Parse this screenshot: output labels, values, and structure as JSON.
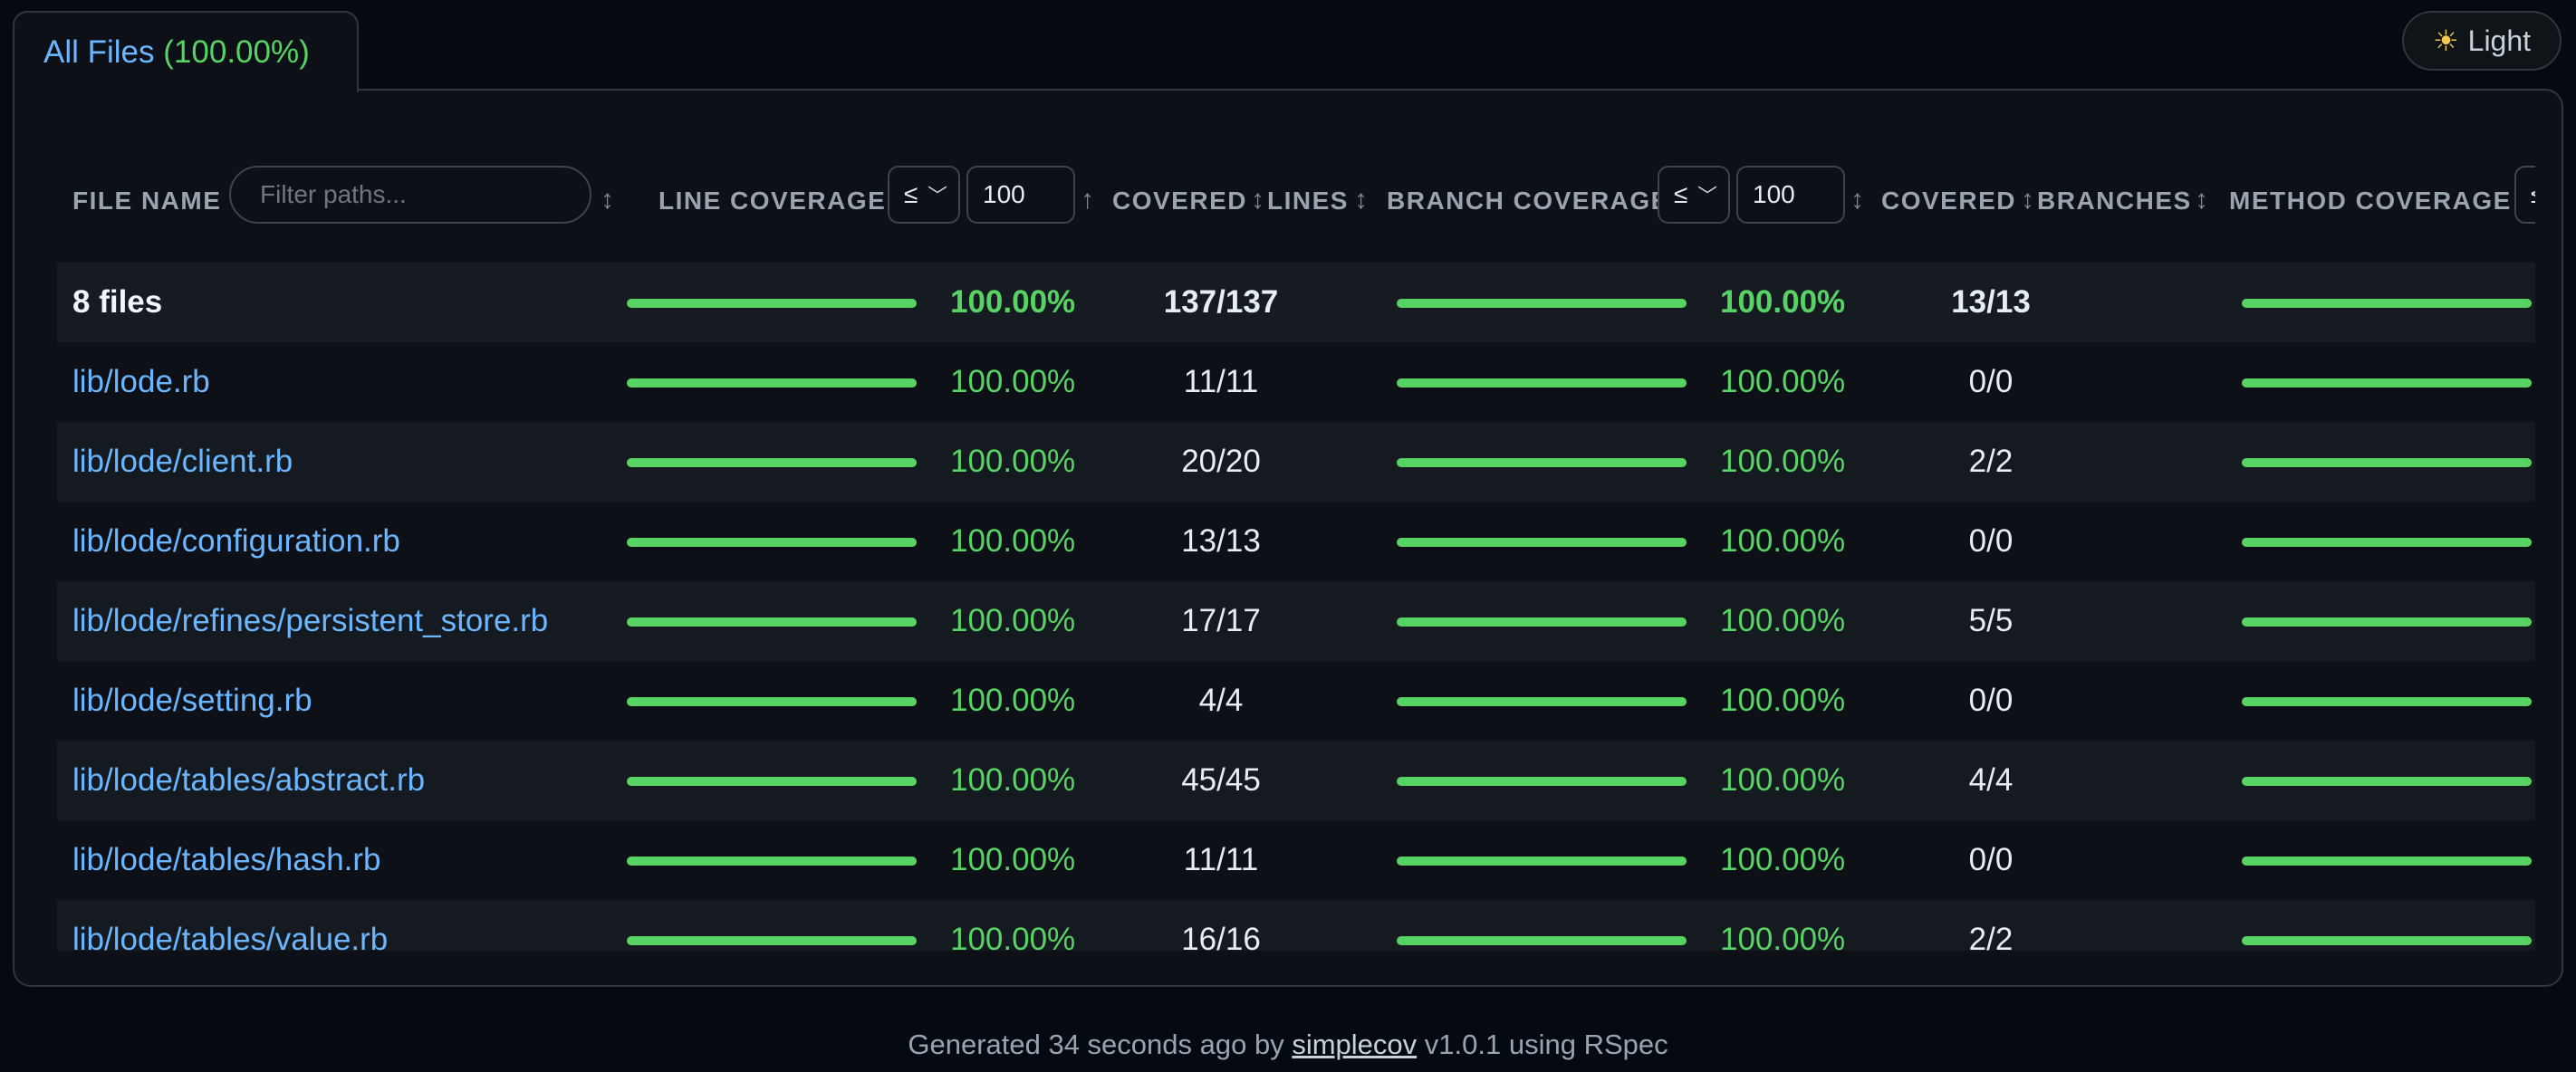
{
  "theme_toggle": {
    "icon": "sun-icon",
    "label": "Light"
  },
  "tab": {
    "label": "All Files",
    "percent": "(100.00%)"
  },
  "colors": {
    "accent_link": "#6cb6ff",
    "coverage_good": "#57d364",
    "background": "#050a12"
  },
  "header": {
    "file_name": "FILE NAME",
    "filter_placeholder": "Filter paths...",
    "line_coverage": "LINE COVERAGE",
    "line_op": "≤",
    "line_value": "100",
    "covered_1": "COVERED",
    "lines": "LINES",
    "branch_coverage": "BRANCH COVERAGE",
    "branch_op": "≤",
    "branch_value": "100",
    "covered_2": "COVERED",
    "branches": "BRANCHES",
    "method_coverage": "METHOD COVERAGE",
    "method_op": "≤"
  },
  "summary": {
    "name": "8 files",
    "line_pct": "100.00%",
    "line_fill": 1.0,
    "lines": "137/137",
    "branch_pct": "100.00%",
    "branch_fill": 1.0,
    "branches": "13/13",
    "method_fill": 1.0
  },
  "files": [
    {
      "name": "lib/lode.rb",
      "line_pct": "100.00%",
      "line_fill": 1.0,
      "lines": "11/11",
      "branch_pct": "100.00%",
      "branch_fill": 1.0,
      "branches": "0/0",
      "method_fill": 1.0
    },
    {
      "name": "lib/lode/client.rb",
      "line_pct": "100.00%",
      "line_fill": 1.0,
      "lines": "20/20",
      "branch_pct": "100.00%",
      "branch_fill": 1.0,
      "branches": "2/2",
      "method_fill": 1.0
    },
    {
      "name": "lib/lode/configuration.rb",
      "line_pct": "100.00%",
      "line_fill": 1.0,
      "lines": "13/13",
      "branch_pct": "100.00%",
      "branch_fill": 1.0,
      "branches": "0/0",
      "method_fill": 1.0
    },
    {
      "name": "lib/lode/refines/persistent_store.rb",
      "line_pct": "100.00%",
      "line_fill": 1.0,
      "lines": "17/17",
      "branch_pct": "100.00%",
      "branch_fill": 1.0,
      "branches": "5/5",
      "method_fill": 1.0
    },
    {
      "name": "lib/lode/setting.rb",
      "line_pct": "100.00%",
      "line_fill": 1.0,
      "lines": "4/4",
      "branch_pct": "100.00%",
      "branch_fill": 1.0,
      "branches": "0/0",
      "method_fill": 1.0
    },
    {
      "name": "lib/lode/tables/abstract.rb",
      "line_pct": "100.00%",
      "line_fill": 1.0,
      "lines": "45/45",
      "branch_pct": "100.00%",
      "branch_fill": 1.0,
      "branches": "4/4",
      "method_fill": 1.0
    },
    {
      "name": "lib/lode/tables/hash.rb",
      "line_pct": "100.00%",
      "line_fill": 1.0,
      "lines": "11/11",
      "branch_pct": "100.00%",
      "branch_fill": 1.0,
      "branches": "0/0",
      "method_fill": 1.0
    },
    {
      "name": "lib/lode/tables/value.rb",
      "line_pct": "100.00%",
      "line_fill": 1.0,
      "lines": "16/16",
      "branch_pct": "100.00%",
      "branch_fill": 1.0,
      "branches": "2/2",
      "method_fill": 1.0
    }
  ],
  "footer": {
    "prefix": "Generated 34 seconds ago by",
    "link": "simplecov",
    "suffix": "v1.0.1 using RSpec"
  }
}
